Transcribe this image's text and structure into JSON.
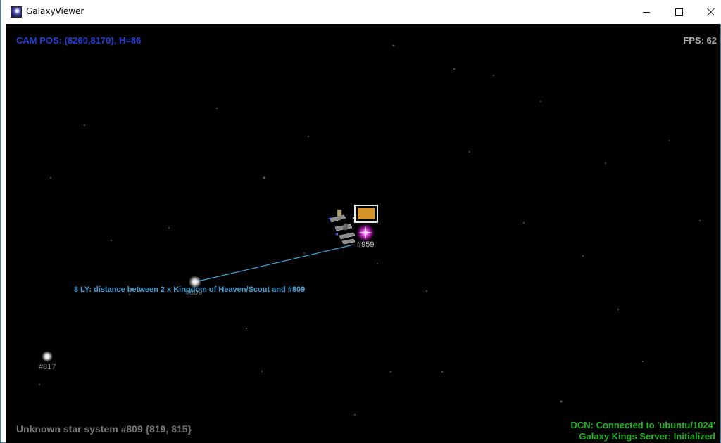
{
  "window": {
    "title": "GalaxyViewer",
    "icons": {
      "app": "galaxy-app-icon",
      "minimize": "minimize-icon",
      "maximize": "maximize-icon",
      "close": "close-icon"
    }
  },
  "hud": {
    "camera": "CAM POS: (8260,8170), H=86",
    "fps": "FPS: 62",
    "system_info": "Unknown star system #809 {819, 815}",
    "connection": "DCN: Connected to 'ubuntu/1024'",
    "server": "Galaxy Kings Server: Initialized"
  },
  "map": {
    "stars": [
      {
        "id": "#959",
        "color": "#ff40ff"
      },
      {
        "id": "#809",
        "color": "#ffffff"
      },
      {
        "id": "#817",
        "color": "#ffffff"
      }
    ],
    "distance_label": "8 LY: distance between 2 x Kingdom of Heaven/Scout and #809",
    "fleet_marker_color": "#d4962a",
    "distance_line_color": "#3fa0d8"
  }
}
